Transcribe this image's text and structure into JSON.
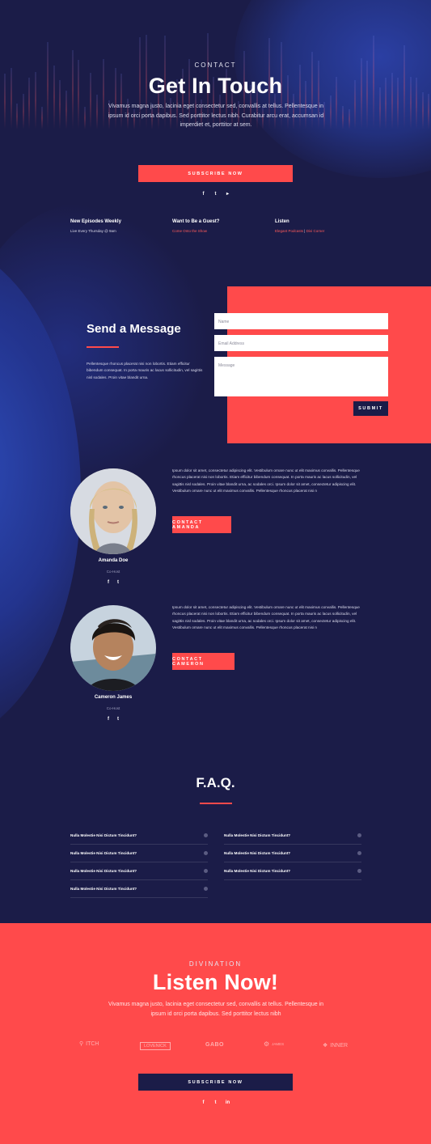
{
  "hero": {
    "eyebrow": "CONTACT",
    "title": "Get In Touch",
    "text": "Vivamus magna justo, lacinia eget consectetur sed, convallis at tellus. Pellentesque in ipsum id orci porta dapibus. Sed porttitor lectus nibh. Curabitur arcu erat, accumsan id imperdiet et, porttitor at sem.",
    "button": "SUBSCRIBE NOW",
    "social": [
      "facebook-icon",
      "twitter-icon",
      "youtube-icon"
    ]
  },
  "info": [
    {
      "title": "New Episodes Weekly",
      "text": "Live Every Thursday @ 9am"
    },
    {
      "title": "Want to Be a Guest?",
      "text": "Come Onto the Show"
    },
    {
      "title": "Listen",
      "text_1": "Elegant Podcasts",
      "sep": "|",
      "text_2": "Divi Corner"
    }
  ],
  "message": {
    "title": "Send a Message",
    "text": "Pellentesque rhoncus placerat nisi non lobortis. Etiam efficitur bibendum consequat. In porta mauris ac lacus sollicitudin, vel sagittis nisl sodales. Proin vitae blandit urna.",
    "name_placeholder": "Name",
    "email_placeholder": "Email Address",
    "message_placeholder": "Message",
    "submit": "SUBMIT"
  },
  "hosts": [
    {
      "name": "Amanda Doe",
      "role": "Co-Host",
      "bio": "Ipsum dolor sit amet, consectetur adipiscing elit. Vestibulum ornare nunc ut elit maximus convallis. Pellentesque rhoncus placerat nisi non lobortis. Etiam efficitur bibendum consequat. In porta mauris ac lacus sollicitudin, vel sagittis nisl sodales. Proin vitae blandit urna, ac sodales orci. Ipsum dolor sit amet, consectetur adipiscing elit. Vestibulum ornare nunc ut elit maximus convallis. Pellentesque rhoncus placerat nisi n",
      "button": "CONTACT AMANDA"
    },
    {
      "name": "Cameron James",
      "role": "Co-Host",
      "bio": "Ipsum dolor sit amet, consectetur adipiscing elit. Vestibulum ornare nunc ut elit maximus convallis. Pellentesque rhoncus placerat nisi non lobortis. Etiam efficitur bibendum consequat. In porta mauris ac lacus sollicitudin, vel sagittis nisl sodales. Proin vitae blandit urna, ac sodales orci. Ipsum dolor sit amet, consectetur adipiscing elit. Vestibulum ornare nunc ut elit maximus convallis. Pellentesque rhoncus placerat nisi n",
      "button": "CONTACT CAMERON"
    }
  ],
  "faq": {
    "title": "F.A.Q.",
    "left": [
      "Nulla Molestie Nisi Dictum Tincidunt?",
      "Nulla Molestie Nisi Dictum Tincidunt?",
      "Nulla Molestie Nisi Dictum Tincidunt?",
      "Nulla Molestie Nisi Dictum Tincidunt?"
    ],
    "right": [
      "Nulla Molestie Nisi Dictum Tincidunt?",
      "Nulla Molestie Nisi Dictum Tincidunt?",
      "Nulla Molestie Nisi Dictum Tincidunt?"
    ]
  },
  "listen": {
    "eyebrow": "DIVINATION",
    "title": "Listen Now!",
    "text": "Vivamus magna justo, lacinia eget consectetur sed, convallis at tellus. Pellentesque in ipsum id orci porta dapibus. Sed porttitor lectus nibh",
    "logos": [
      "ITCH",
      "LOVENICK",
      "GABO",
      "JAMES",
      "INNER"
    ],
    "button": "SUBSCRIBE NOW",
    "social": [
      "facebook-icon",
      "twitter-icon",
      "linkedin-icon"
    ]
  },
  "colors": {
    "navy": "#1b1c48",
    "coral": "#ff4a4b",
    "blue": "#2d4bb8"
  }
}
